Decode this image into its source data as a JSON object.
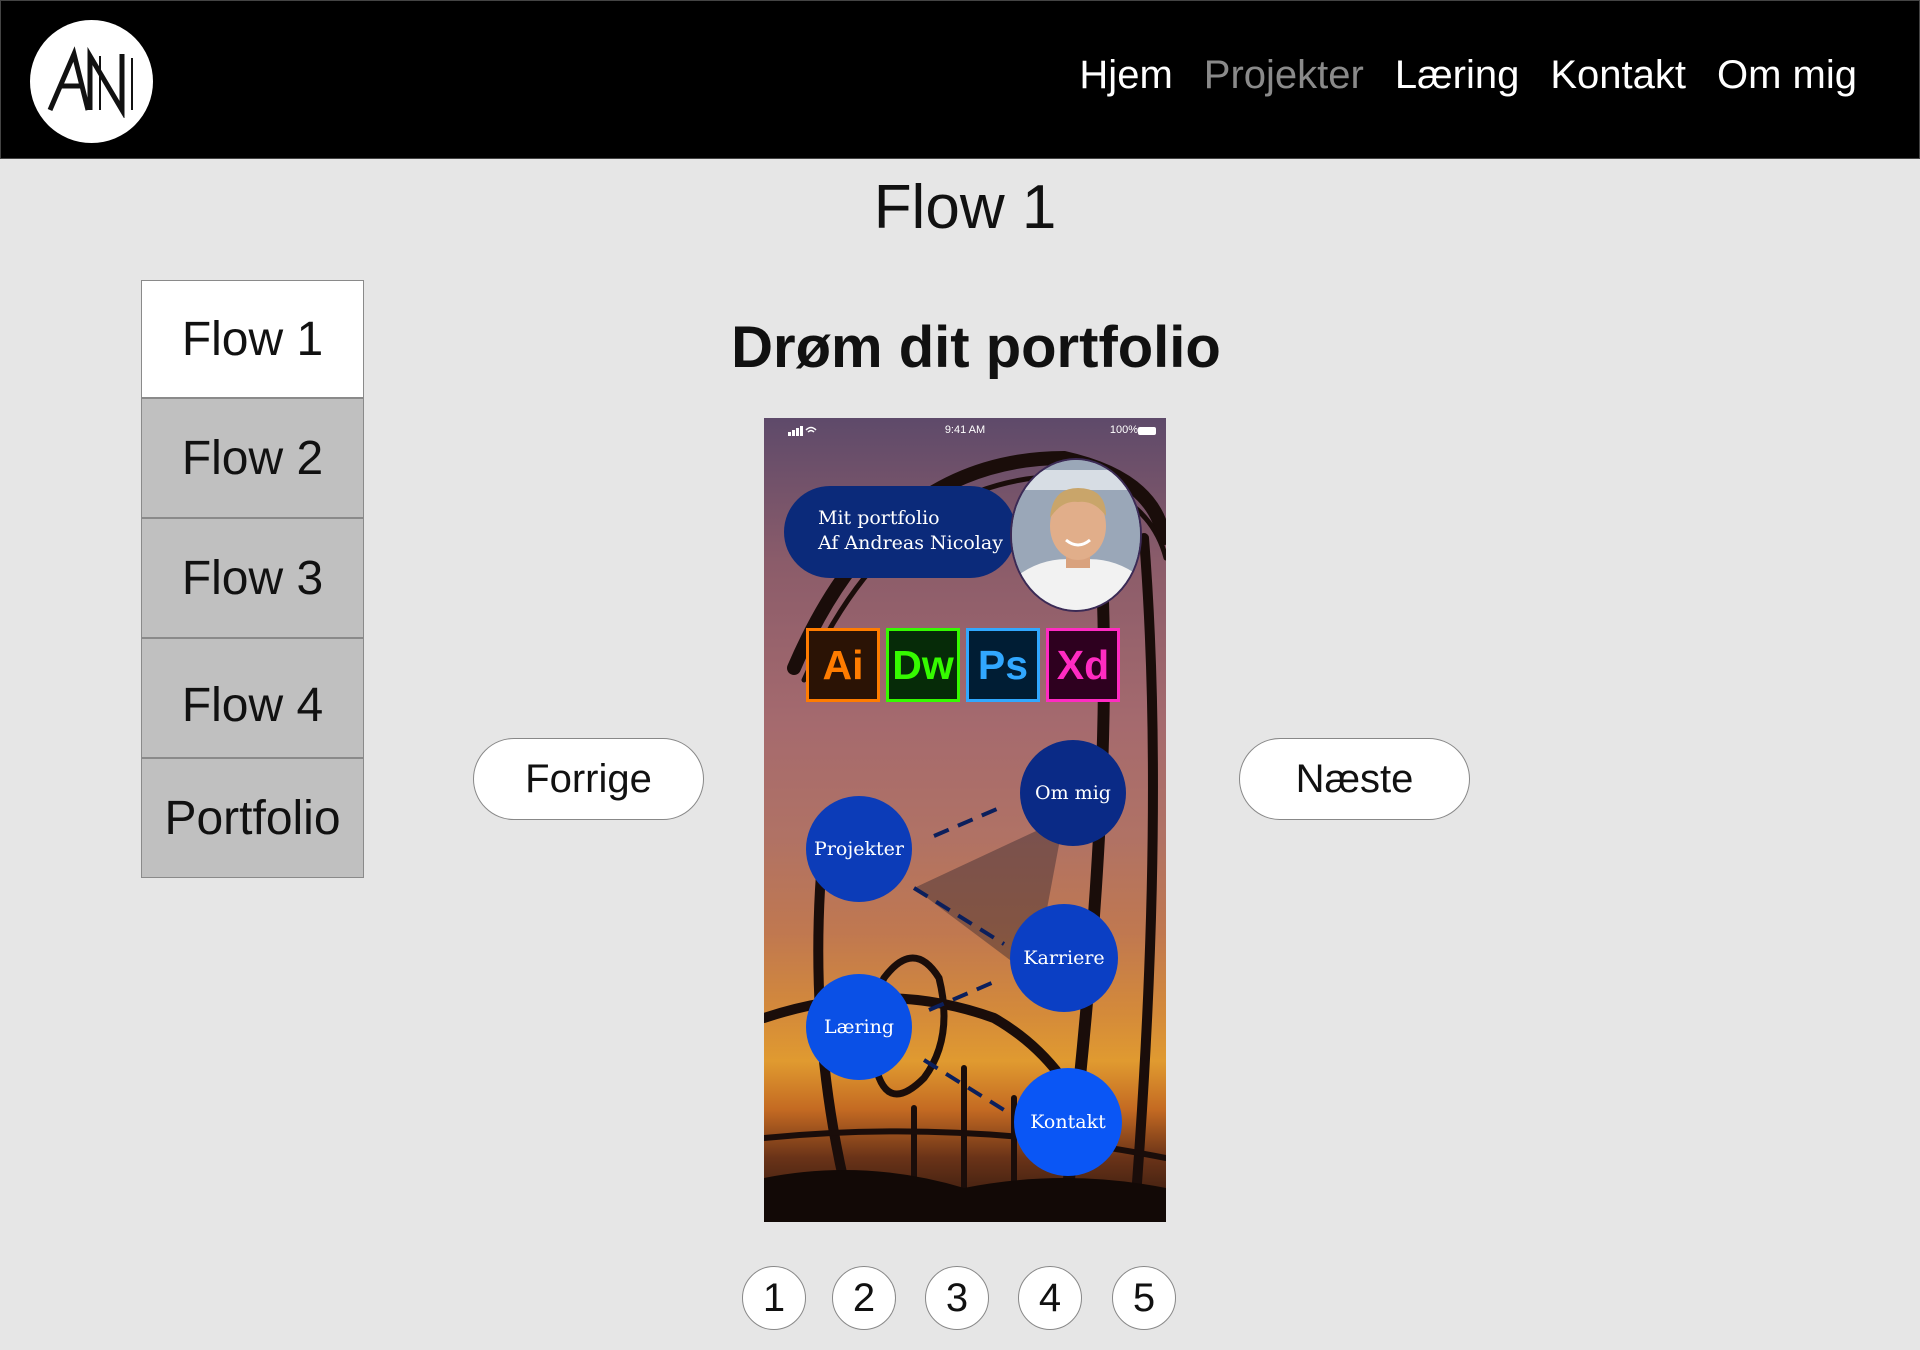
{
  "header": {
    "logo_text": "AN",
    "nav": [
      {
        "label": "Hjem",
        "active": false
      },
      {
        "label": "Projekter",
        "active": true
      },
      {
        "label": "Læring",
        "active": false
      },
      {
        "label": "Kontakt",
        "active": false
      },
      {
        "label": "Om mig",
        "active": false
      }
    ]
  },
  "page_title": "Flow 1",
  "sidebar": {
    "items": [
      {
        "label": "Flow 1",
        "active": true
      },
      {
        "label": "Flow 2",
        "active": false
      },
      {
        "label": "Flow 3",
        "active": false
      },
      {
        "label": "Flow 4",
        "active": false
      },
      {
        "label": "Portfolio",
        "active": false
      }
    ]
  },
  "slide": {
    "title": "Drøm dit portfolio",
    "prev_label": "Forrige",
    "next_label": "Næste"
  },
  "phone": {
    "status_time": "9:41 AM",
    "status_battery": "100%",
    "card_line1": "Mit portfolio",
    "card_line2": "Af Andreas Nicolay",
    "tools": [
      {
        "label": "Ai",
        "color": "#ff7c00",
        "bg": "#2b1305"
      },
      {
        "label": "Dw",
        "color": "#35fa00",
        "bg": "#062b08"
      },
      {
        "label": "Ps",
        "color": "#31a8ff",
        "bg": "#001d34"
      },
      {
        "label": "Xd",
        "color": "#ff2bc2",
        "bg": "#2e001f"
      }
    ],
    "nodes": {
      "om_mig": "Om mig",
      "projekter": "Projekter",
      "karriere": "Karriere",
      "laering": "Læring",
      "kontakt": "Kontakt"
    }
  },
  "pager": [
    "1",
    "2",
    "3",
    "4",
    "5"
  ]
}
